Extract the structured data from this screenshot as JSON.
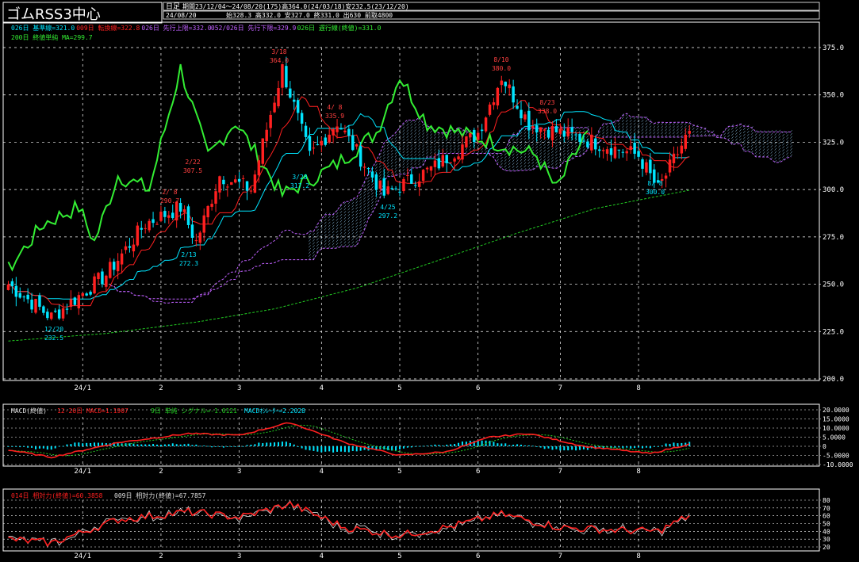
{
  "header": {
    "title": "ゴムRSS3中心",
    "period_type": "日足",
    "stats_line": "期間23/12/04〜24/08/20(175)高364.0(24/03/18)安232.5(23/12/20)",
    "date": "24/08/20",
    "ohlc_line": "始328.3 高332.0 安327.0 終331.0 出630 前取4800"
  },
  "colors": {
    "background": "#000000",
    "up_candle": "#ff2020",
    "down_candle": "#00e5ff",
    "tenkan": "#ff2020",
    "kijun": "#00e5ff",
    "span_a": "#c060ff",
    "span_b": "#c060ff",
    "chikou": "#33ee33",
    "ma200": "#22cc22",
    "grid": "#ffffff",
    "macd_line": "#ff2020",
    "macd_signal": "#22cc22",
    "macd_hist": "#00e5ff",
    "rsi14": "#ff2020",
    "rsi9": "#e0e0e0"
  },
  "main_chart": {
    "legend_row1": [
      {
        "text": "026日 基準線=321.0",
        "color": "#00e5ff"
      },
      {
        "text": "009日 転換線=322.8",
        "color": "#ff2020"
      },
      {
        "text": "026日 先行上限=332.0",
        "color": "#c060ff"
      },
      {
        "text": "052/026日 先行下限=329.9",
        "color": "#c060ff"
      },
      {
        "text": "026日 遅行線(終値)=331.0",
        "color": "#33ee33"
      }
    ],
    "legend_row2": [
      {
        "text": "200日 終値単純 MA=299.7",
        "color": "#33ee33"
      }
    ],
    "y_ticks": [
      "375.0",
      "350.0",
      "325.0",
      "300.0",
      "275.0",
      "250.0",
      "225.0",
      "200.0"
    ],
    "annotations": [
      {
        "date": "3/18",
        "price": "364.0"
      },
      {
        "date": "8/10",
        "price": "380.0"
      },
      {
        "date": "4/ 8",
        "price": "335.9"
      },
      {
        "date": "8/23",
        "price": "338.0"
      },
      {
        "date": "2/ 8",
        "price": "290.7"
      },
      {
        "date": "2/22",
        "price": "307.5"
      },
      {
        "date": "3/28",
        "price": "317.2"
      },
      {
        "date": "2/13",
        "price": "272.3"
      },
      {
        "date": "4/25",
        "price": "297.2"
      },
      {
        "date": "8/ 8",
        "price": "300.0"
      },
      {
        "date": "12/20",
        "price": "232.5"
      }
    ]
  },
  "x_ticks": [
    "24/1",
    "2",
    "3",
    "4",
    "5",
    "6",
    "7",
    "8"
  ],
  "macd_panel": {
    "legend": [
      {
        "text": "MACD(終値)",
        "color": "#e0e0e0"
      },
      {
        "text": "12-26日 MACD=1.1907",
        "color": "#ff2020"
      },
      {
        "text": "9日 単純 シグナル=-1.0121",
        "color": "#22cc22"
      },
      {
        "text": "MACDｵｼﾚｰﾀｰ=2.2028",
        "color": "#00e5ff"
      }
    ],
    "y_ticks": [
      "20.0000",
      "15.0000",
      "10.0000",
      "5.0000",
      "0",
      "-5.0000",
      "-10.0000"
    ]
  },
  "rsi_panel": {
    "legend": [
      {
        "text": "014日 相対力(終値)=60.3858",
        "color": "#ff2020"
      },
      {
        "text": "009日 相対力(終値)=67.7857",
        "color": "#e0e0e0"
      }
    ],
    "y_ticks": [
      "80",
      "70",
      "60",
      "50",
      "40",
      "30",
      "20"
    ]
  },
  "chart_data": {
    "type": "line",
    "title": "ゴムRSS3中心",
    "x_tick_labels": [
      "24/1",
      "2",
      "3",
      "4",
      "5",
      "6",
      "7",
      "8"
    ],
    "ylim": [
      200,
      375
    ],
    "close_series_keypoints": {
      "name": "終値",
      "x": [
        "23/12/04",
        "23/12/20",
        "24/01/10",
        "24/01/25",
        "24/02/08",
        "24/02/13",
        "24/02/22",
        "24/03/05",
        "24/03/18",
        "24/03/28",
        "24/04/08",
        "24/04/25",
        "24/05/15",
        "24/06/01",
        "24/06/10",
        "24/06/20",
        "24/07/01",
        "24/07/15",
        "24/08/01",
        "24/08/08",
        "24/08/20"
      ],
      "values": [
        250,
        232.5,
        255,
        282,
        290.7,
        272.3,
        307.5,
        300,
        364,
        317.2,
        335.9,
        297.2,
        312,
        330,
        360,
        335,
        330,
        325,
        318,
        300,
        331
      ]
    },
    "ma200_keypoints": {
      "name": "200日 終値単純 MA",
      "x": [
        "23/12/04",
        "24/01/10",
        "24/02/13",
        "24/03/15",
        "24/04/15",
        "24/05/15",
        "24/06/15",
        "24/07/15",
        "24/08/20"
      ],
      "values": [
        220,
        224,
        230,
        237,
        248,
        262,
        277,
        290,
        299.7
      ]
    },
    "macd_keypoints": {
      "name": "MACD",
      "x": [
        "23/12/04",
        "23/12/20",
        "24/01/15",
        "24/02/10",
        "24/03/01",
        "24/03/20",
        "24/04/10",
        "24/05/01",
        "24/05/20",
        "24/06/05",
        "24/06/20",
        "24/07/10",
        "24/08/05",
        "24/08/20"
      ],
      "values": [
        -2,
        -6,
        2,
        7,
        6,
        13,
        2,
        -5,
        -3,
        5,
        7,
        0,
        -4,
        1.19
      ]
    },
    "rsi14_keypoints": {
      "name": "014日 相対力",
      "x": [
        "23/12/04",
        "23/12/20",
        "24/01/15",
        "24/02/10",
        "24/03/01",
        "24/03/20",
        "24/04/10",
        "24/05/01",
        "24/05/20",
        "24/06/10",
        "24/07/01",
        "24/07/20",
        "24/08/08",
        "24/08/20"
      ],
      "values": [
        30,
        25,
        55,
        65,
        58,
        75,
        45,
        35,
        45,
        62,
        45,
        42,
        40,
        60.39
      ]
    }
  }
}
